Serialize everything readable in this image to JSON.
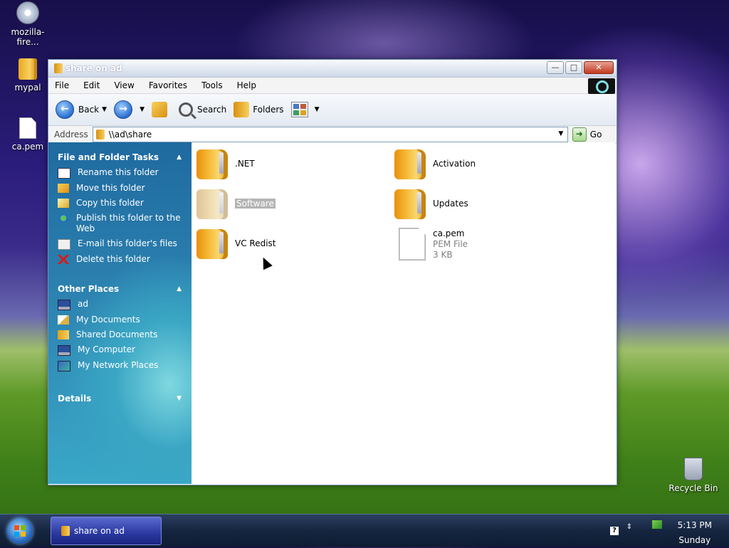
{
  "desktop": {
    "icons": [
      {
        "label": "mozilla-fire..."
      },
      {
        "label": "mypal"
      },
      {
        "label": "ca.pem"
      },
      {
        "label": "Recycle Bin"
      }
    ]
  },
  "window": {
    "title": "share on ad",
    "menu": [
      "File",
      "Edit",
      "View",
      "Favorites",
      "Tools",
      "Help"
    ],
    "toolbar": {
      "back": "Back",
      "search": "Search",
      "folders": "Folders"
    },
    "address": {
      "label": "Address",
      "value": "\\\\ad\\share",
      "go": "Go"
    },
    "task_pane": {
      "file_tasks": {
        "title": "File and Folder Tasks",
        "items": [
          "Rename this folder",
          "Move this folder",
          "Copy this folder",
          "Publish this folder to the Web",
          "E-mail this folder's files",
          "Delete this folder"
        ]
      },
      "other_places": {
        "title": "Other Places",
        "items": [
          "ad",
          "My Documents",
          "Shared Documents",
          "My Computer",
          "My Network Places"
        ]
      },
      "details": {
        "title": "Details"
      }
    },
    "content": {
      "folders": [
        ".NET",
        "Activation",
        "Software",
        "Updates",
        "VC Redist"
      ],
      "file": {
        "name": "ca.pem",
        "type": "PEM File",
        "size": "3 KB"
      }
    }
  },
  "taskbar": {
    "task": "share on ad",
    "time": "5:13 PM",
    "day": "Sunday",
    "help_glyph": "?"
  }
}
